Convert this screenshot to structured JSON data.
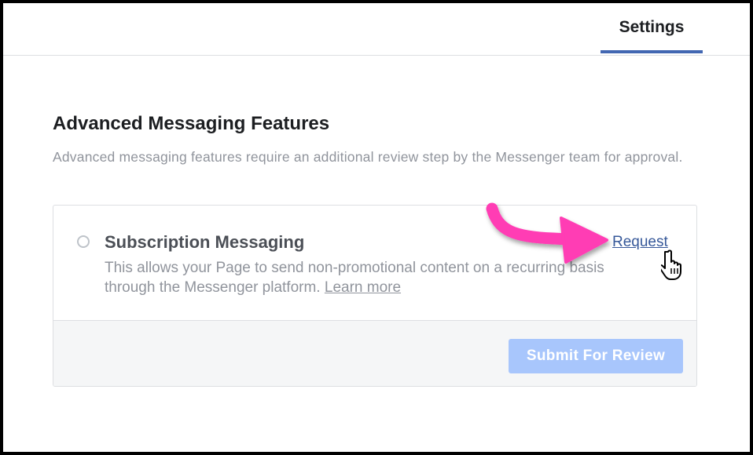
{
  "header": {
    "tabs": [
      {
        "label": "Settings",
        "active": true
      }
    ],
    "accent_color": "#4267b2"
  },
  "section": {
    "title": "Advanced Messaging Features",
    "description": "Advanced messaging features require an additional review step by the Messenger team for approval."
  },
  "feature": {
    "title": "Subscription Messaging",
    "request_label": "Request",
    "description_line1": "This allows your Page to send non-promotional content on a recurring basis",
    "description_line2": "through the Messenger platform.",
    "learn_more_label": "Learn more",
    "selected": false
  },
  "footer": {
    "submit_label": "Submit For Review",
    "submit_enabled": false,
    "submit_color": "#a8c6fc"
  },
  "annotation": {
    "arrow_color": "#ff3cb4",
    "cursor_icon": "hand-pointer-icon"
  }
}
